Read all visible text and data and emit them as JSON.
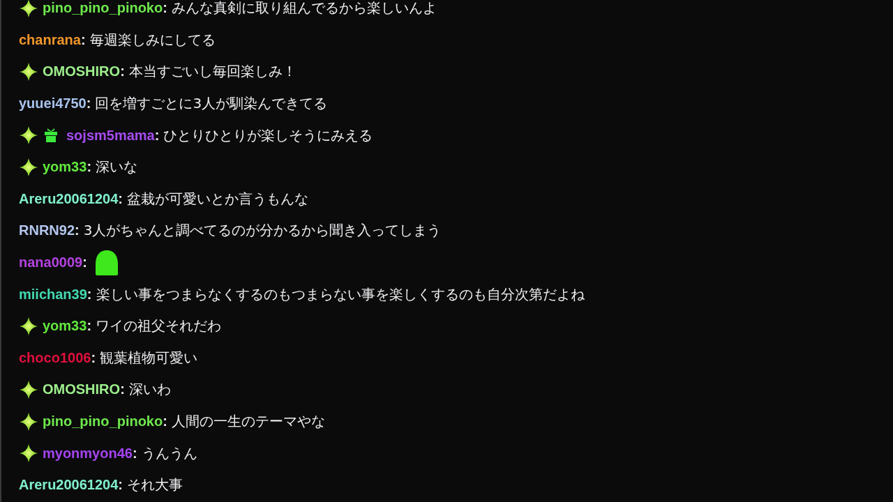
{
  "messages": [
    {
      "user": "pino_pino_pinoko",
      "colon": ":",
      "color": "#6ee84c",
      "badges": [
        {
          "kind": "sparkle"
        }
      ],
      "kind": "text",
      "text": "みんな真剣に取り組んでるから楽しいんよ"
    },
    {
      "user": "chanrana",
      "colon": ":",
      "color": "#f0962a",
      "kind": "text",
      "text": "毎週楽しみにしてる"
    },
    {
      "user": "OMOSHIRO",
      "colon": ":",
      "color": "#9ef08c",
      "badges": [
        {
          "kind": "sparkle"
        }
      ],
      "kind": "text",
      "text": "本当すごいし毎回楽しみ！"
    },
    {
      "user": "yuuei4750",
      "colon": ":",
      "color": "#a8c4ee",
      "kind": "text",
      "text": "回を増すごとに3人が馴染んできてる"
    },
    {
      "user": "sojsm5mama",
      "colon": ":",
      "color": "#a64cf0",
      "badges": [
        {
          "kind": "sparkle"
        },
        {
          "kind": "gift"
        }
      ],
      "kind": "text",
      "text": "ひとりひとりが楽しそうにみえる"
    },
    {
      "user": "yom33",
      "colon": ":",
      "color": "#62e83e",
      "badges": [
        {
          "kind": "sparkle"
        }
      ],
      "kind": "text",
      "text": "深いな"
    },
    {
      "user": "Areru20061204",
      "colon": ":",
      "color": "#80f0cc",
      "kind": "text",
      "text": "盆栽が可愛いとか言うもんな"
    },
    {
      "user": "RNRN92",
      "colon": ":",
      "color": "#b4c6ee",
      "kind": "text",
      "text": "3人がちゃんと調べてるのが分かるから聞き入ってしまう"
    },
    {
      "user": "nana0009",
      "colon": ":",
      "color": "#b444e0",
      "kind": "emote"
    },
    {
      "user": "miichan39",
      "colon": ":",
      "color": "#44d8b0",
      "kind": "text",
      "text": "楽しい事をつまらなくするのもつまらない事を楽しくするのも自分次第だよね"
    },
    {
      "user": "yom33",
      "colon": ":",
      "color": "#62e83e",
      "badges": [
        {
          "kind": "sparkle"
        }
      ],
      "kind": "text",
      "text": "ワイの祖父それだわ"
    },
    {
      "user": "choco1006",
      "colon": ":",
      "color": "#e0103c",
      "kind": "text",
      "text": "観葉植物可愛い"
    },
    {
      "user": "OMOSHIRO",
      "colon": ":",
      "color": "#9ef08c",
      "badges": [
        {
          "kind": "sparkle"
        }
      ],
      "kind": "text",
      "text": "深いわ"
    },
    {
      "user": "pino_pino_pinoko",
      "colon": ":",
      "color": "#6ee84c",
      "badges": [
        {
          "kind": "sparkle"
        }
      ],
      "kind": "text",
      "text": "人間の一生のテーマやな"
    },
    {
      "user": "myonmyon46",
      "colon": ":",
      "color": "#a444f0",
      "badges": [
        {
          "kind": "sparkle"
        }
      ],
      "kind": "text",
      "text": "うんうん"
    },
    {
      "user": "Areru20061204",
      "colon": ":",
      "color": "#80f0cc",
      "kind": "text",
      "text": "それ大事"
    }
  ]
}
